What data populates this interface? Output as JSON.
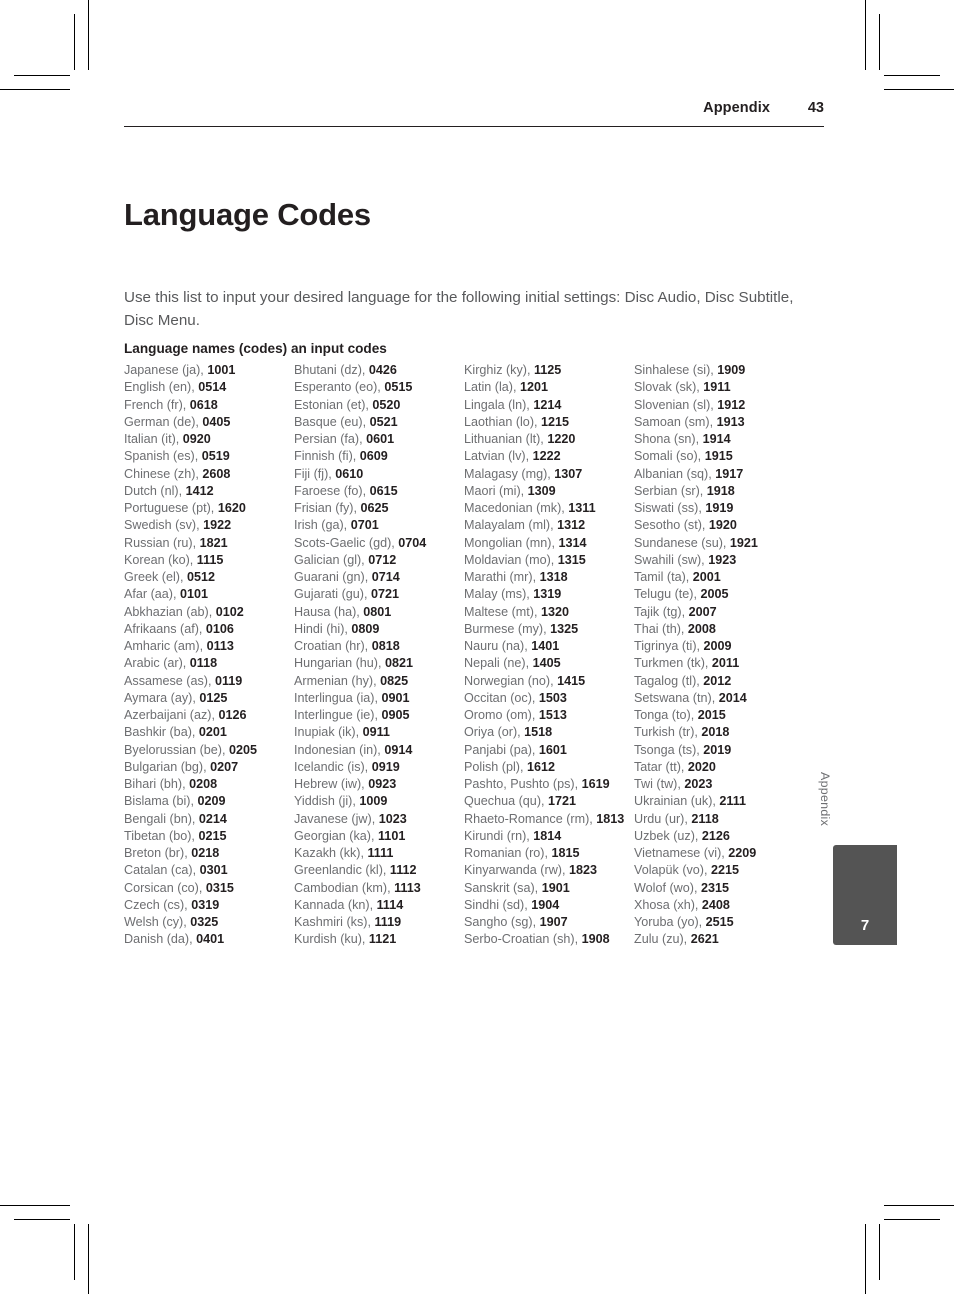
{
  "header": {
    "label": "Appendix",
    "page_number": "43"
  },
  "title": "Language Codes",
  "intro": "Use this list to input your desired language for the following initial settings: Disc Audio, Disc Subtitle, Disc Menu.",
  "subheading": "Language names (codes) an input codes",
  "side_tab": {
    "label": "Appendix",
    "number": "7"
  },
  "columns": [
    {
      "entries": [
        {
          "name": "Japanese (ja), ",
          "code": "1001"
        },
        {
          "name": "English (en), ",
          "code": "0514"
        },
        {
          "name": "French (fr), ",
          "code": "0618"
        },
        {
          "name": "German (de), ",
          "code": "0405"
        },
        {
          "name": "Italian (it), ",
          "code": "0920"
        },
        {
          "name": "Spanish (es), ",
          "code": "0519"
        },
        {
          "name": "Chinese (zh), ",
          "code": "2608"
        },
        {
          "name": "Dutch (nl), ",
          "code": "1412"
        },
        {
          "name": "Portuguese (pt), ",
          "code": "1620"
        },
        {
          "name": "Swedish (sv), ",
          "code": "1922"
        },
        {
          "name": "Russian (ru), ",
          "code": "1821"
        },
        {
          "name": "Korean (ko), ",
          "code": "1115"
        },
        {
          "name": "Greek (el), ",
          "code": "0512"
        },
        {
          "name": "Afar (aa), ",
          "code": "0101"
        },
        {
          "name": "Abkhazian (ab), ",
          "code": "0102"
        },
        {
          "name": "Afrikaans (af), ",
          "code": "0106"
        },
        {
          "name": "Amharic (am), ",
          "code": "0113"
        },
        {
          "name": "Arabic (ar), ",
          "code": "0118"
        },
        {
          "name": "Assamese (as), ",
          "code": "0119"
        },
        {
          "name": "Aymara (ay), ",
          "code": "0125"
        },
        {
          "name": "Azerbaijani (az), ",
          "code": "0126"
        },
        {
          "name": "Bashkir (ba), ",
          "code": "0201"
        },
        {
          "name": "Byelorussian (be), ",
          "code": "0205"
        },
        {
          "name": "Bulgarian (bg), ",
          "code": "0207"
        },
        {
          "name": "Bihari (bh), ",
          "code": "0208"
        },
        {
          "name": "Bislama (bi), ",
          "code": "0209"
        },
        {
          "name": "Bengali (bn), ",
          "code": "0214"
        },
        {
          "name": "Tibetan (bo), ",
          "code": "0215"
        },
        {
          "name": "Breton (br), ",
          "code": "0218"
        },
        {
          "name": "Catalan (ca), ",
          "code": "0301"
        },
        {
          "name": "Corsican (co), ",
          "code": "0315"
        },
        {
          "name": "Czech (cs), ",
          "code": "0319"
        },
        {
          "name": "Welsh (cy), ",
          "code": "0325"
        },
        {
          "name": "Danish (da), ",
          "code": "0401"
        }
      ]
    },
    {
      "entries": [
        {
          "name": "Bhutani (dz), ",
          "code": "0426"
        },
        {
          "name": "Esperanto (eo), ",
          "code": "0515"
        },
        {
          "name": "Estonian (et), ",
          "code": "0520"
        },
        {
          "name": "Basque (eu), ",
          "code": "0521"
        },
        {
          "name": "Persian (fa), ",
          "code": "0601"
        },
        {
          "name": "Finnish (fi), ",
          "code": "0609"
        },
        {
          "name": "Fiji (fj), ",
          "code": "0610"
        },
        {
          "name": "Faroese (fo), ",
          "code": "0615"
        },
        {
          "name": "Frisian (fy), ",
          "code": "0625"
        },
        {
          "name": "Irish (ga), ",
          "code": "0701"
        },
        {
          "name": "Scots-Gaelic (gd), ",
          "code": "0704"
        },
        {
          "name": "Galician (gl), ",
          "code": "0712"
        },
        {
          "name": "Guarani (gn), ",
          "code": "0714"
        },
        {
          "name": "Gujarati (gu), ",
          "code": "0721"
        },
        {
          "name": "Hausa (ha), ",
          "code": "0801"
        },
        {
          "name": "Hindi (hi), ",
          "code": "0809"
        },
        {
          "name": "Croatian (hr), ",
          "code": "0818"
        },
        {
          "name": "Hungarian (hu), ",
          "code": "0821"
        },
        {
          "name": "Armenian (hy), ",
          "code": "0825"
        },
        {
          "name": "Interlingua (ia), ",
          "code": "0901"
        },
        {
          "name": "Interlingue (ie), ",
          "code": "0905"
        },
        {
          "name": "Inupiak (ik), ",
          "code": "0911"
        },
        {
          "name": "Indonesian (in), ",
          "code": "0914"
        },
        {
          "name": "Icelandic (is), ",
          "code": "0919"
        },
        {
          "name": "Hebrew (iw), ",
          "code": "0923"
        },
        {
          "name": "Yiddish (ji), ",
          "code": "1009"
        },
        {
          "name": "Javanese (jw), ",
          "code": "1023"
        },
        {
          "name": "Georgian (ka), ",
          "code": "1101"
        },
        {
          "name": "Kazakh (kk), ",
          "code": "1111"
        },
        {
          "name": "Greenlandic (kl), ",
          "code": "1112"
        },
        {
          "name": "Cambodian (km), ",
          "code": "1113"
        },
        {
          "name": "Kannada (kn), ",
          "code": "1114"
        },
        {
          "name": "Kashmiri (ks), ",
          "code": "1119"
        },
        {
          "name": "Kurdish (ku), ",
          "code": "1121"
        }
      ]
    },
    {
      "entries": [
        {
          "name": "Kirghiz (ky), ",
          "code": "1125"
        },
        {
          "name": "Latin (la), ",
          "code": "1201"
        },
        {
          "name": "Lingala (ln), ",
          "code": "1214"
        },
        {
          "name": "Laothian (lo), ",
          "code": "1215"
        },
        {
          "name": "Lithuanian (lt), ",
          "code": "1220"
        },
        {
          "name": "Latvian (lv), ",
          "code": "1222"
        },
        {
          "name": "Malagasy (mg), ",
          "code": "1307"
        },
        {
          "name": "Maori (mi), ",
          "code": "1309"
        },
        {
          "name": "Macedonian (mk), ",
          "code": "1311"
        },
        {
          "name": "Malayalam (ml), ",
          "code": "1312"
        },
        {
          "name": "Mongolian (mn), ",
          "code": "1314"
        },
        {
          "name": "Moldavian (mo), ",
          "code": "1315"
        },
        {
          "name": "Marathi (mr), ",
          "code": "1318"
        },
        {
          "name": "Malay (ms), ",
          "code": "1319"
        },
        {
          "name": "Maltese (mt), ",
          "code": "1320"
        },
        {
          "name": "Burmese (my), ",
          "code": "1325"
        },
        {
          "name": "Nauru (na), ",
          "code": "1401"
        },
        {
          "name": "Nepali (ne), ",
          "code": "1405"
        },
        {
          "name": "Norwegian (no), ",
          "code": "1415"
        },
        {
          "name": "Occitan (oc), ",
          "code": "1503"
        },
        {
          "name": "Oromo (om), ",
          "code": "1513"
        },
        {
          "name": "Oriya (or), ",
          "code": "1518"
        },
        {
          "name": "Panjabi (pa), ",
          "code": "1601"
        },
        {
          "name": "Polish (pl), ",
          "code": "1612"
        },
        {
          "name": "Pashto, Pushto (ps), ",
          "code": "1619"
        },
        {
          "name": "Quechua (qu), ",
          "code": "1721"
        },
        {
          "name": "Rhaeto-Romance (rm), ",
          "code": "1813"
        },
        {
          "name": "Kirundi (rn), ",
          "code": "1814"
        },
        {
          "name": "Romanian (ro), ",
          "code": "1815"
        },
        {
          "name": "Kinyarwanda (rw), ",
          "code": "1823"
        },
        {
          "name": "Sanskrit (sa), ",
          "code": "1901"
        },
        {
          "name": "Sindhi (sd), ",
          "code": "1904"
        },
        {
          "name": "Sangho (sg), ",
          "code": "1907"
        },
        {
          "name": "Serbo-Croatian (sh), ",
          "code": "1908"
        }
      ]
    },
    {
      "entries": [
        {
          "name": "Sinhalese (si), ",
          "code": "1909"
        },
        {
          "name": "Slovak (sk), ",
          "code": "1911"
        },
        {
          "name": "Slovenian (sl), ",
          "code": "1912"
        },
        {
          "name": "Samoan (sm), ",
          "code": "1913"
        },
        {
          "name": "Shona (sn), ",
          "code": "1914"
        },
        {
          "name": "Somali (so), ",
          "code": "1915"
        },
        {
          "name": "Albanian (sq), ",
          "code": "1917"
        },
        {
          "name": "Serbian (sr), ",
          "code": "1918"
        },
        {
          "name": "Siswati (ss), ",
          "code": "1919"
        },
        {
          "name": "Sesotho (st), ",
          "code": "1920"
        },
        {
          "name": "Sundanese (su), ",
          "code": "1921"
        },
        {
          "name": "Swahili (sw), ",
          "code": "1923"
        },
        {
          "name": "Tamil (ta), ",
          "code": "2001"
        },
        {
          "name": "Telugu (te), ",
          "code": "2005"
        },
        {
          "name": "Tajik (tg), ",
          "code": "2007"
        },
        {
          "name": "Thai (th), ",
          "code": "2008"
        },
        {
          "name": "Tigrinya (ti), ",
          "code": "2009"
        },
        {
          "name": "Turkmen (tk), ",
          "code": "2011"
        },
        {
          "name": "Tagalog (tl), ",
          "code": "2012"
        },
        {
          "name": "Setswana (tn), ",
          "code": "2014"
        },
        {
          "name": "Tonga (to), ",
          "code": "2015"
        },
        {
          "name": "Turkish (tr), ",
          "code": "2018"
        },
        {
          "name": "Tsonga (ts), ",
          "code": "2019"
        },
        {
          "name": "Tatar (tt), ",
          "code": "2020"
        },
        {
          "name": "Twi (tw), ",
          "code": "2023"
        },
        {
          "name": "Ukrainian (uk), ",
          "code": "2111"
        },
        {
          "name": "Urdu (ur), ",
          "code": "2118"
        },
        {
          "name": "Uzbek (uz), ",
          "code": "2126"
        },
        {
          "name": "Vietnamese (vi), ",
          "code": "2209"
        },
        {
          "name": "Volapük (vo), ",
          "code": "2215"
        },
        {
          "name": "Wolof (wo), ",
          "code": "2315"
        },
        {
          "name": "Xhosa (xh), ",
          "code": "2408"
        },
        {
          "name": "Yoruba (yo), ",
          "code": "2515"
        },
        {
          "name": "Zulu (zu), ",
          "code": "2621"
        }
      ]
    }
  ]
}
